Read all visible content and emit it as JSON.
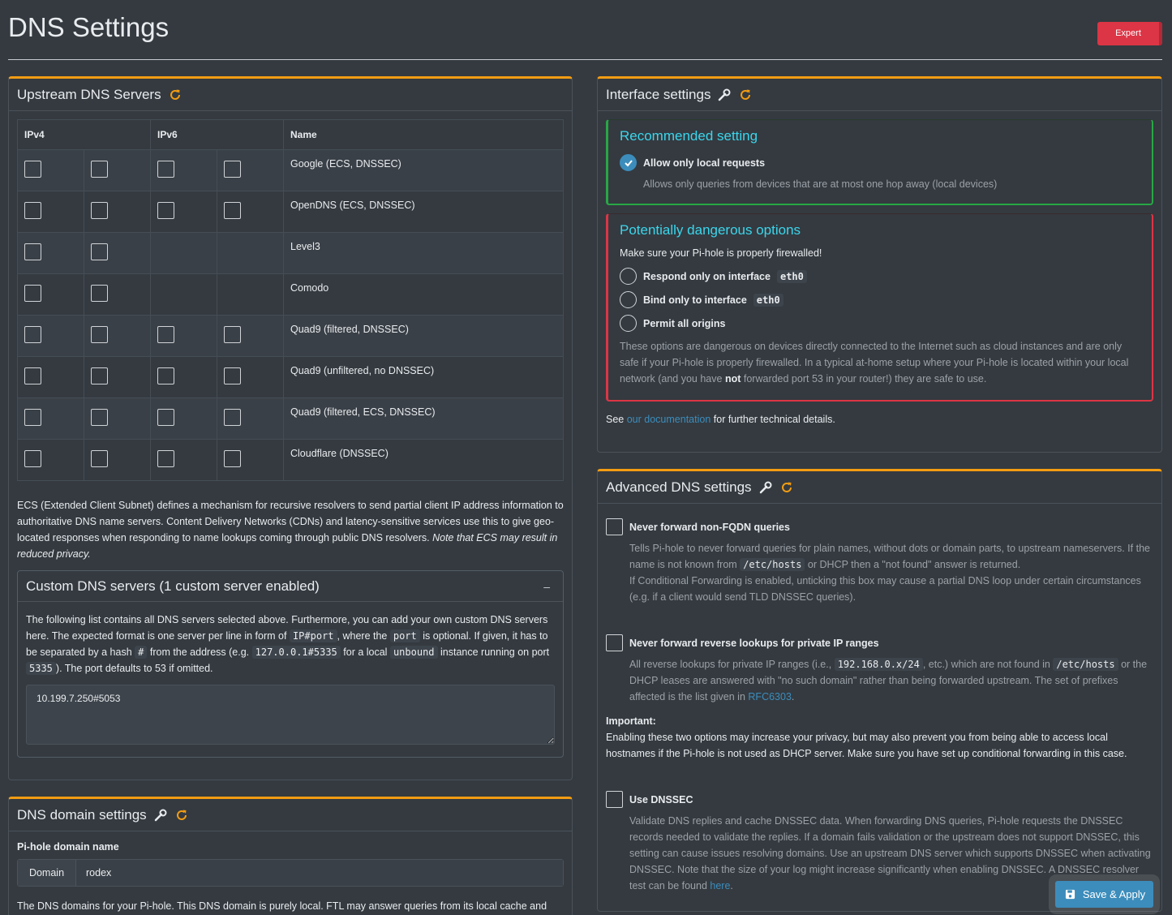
{
  "page": {
    "title": "DNS Settings",
    "expert_label": "Expert"
  },
  "upstream": {
    "title": "Upstream DNS Servers",
    "headers": {
      "ipv4": "IPv4",
      "ipv6": "IPv6",
      "name": "Name"
    },
    "rows": [
      {
        "name": "Google (ECS, DNSSEC)",
        "v4": 2,
        "v6": 2
      },
      {
        "name": "OpenDNS (ECS, DNSSEC)",
        "v4": 2,
        "v6": 2
      },
      {
        "name": "Level3",
        "v4": 2,
        "v6": 0
      },
      {
        "name": "Comodo",
        "v4": 2,
        "v6": 0
      },
      {
        "name": "Quad9 (filtered, DNSSEC)",
        "v4": 2,
        "v6": 2
      },
      {
        "name": "Quad9 (unfiltered, no DNSSEC)",
        "v4": 2,
        "v6": 2
      },
      {
        "name": "Quad9 (filtered, ECS, DNSSEC)",
        "v4": 2,
        "v6": 2
      },
      {
        "name": "Cloudflare (DNSSEC)",
        "v4": 2,
        "v6": 2
      }
    ],
    "ecs_text": "ECS (Extended Client Subnet) defines a mechanism for recursive resolvers to send partial client IP address information to authoritative DNS name servers. Content Delivery Networks (CDNs) and latency-sensitive services use this to give geo-located responses when responding to name lookups coming through public DNS resolvers.",
    "ecs_note": "Note that ECS may result in reduced privacy.",
    "custom": {
      "title": "Custom DNS servers (1 custom server enabled)",
      "collapse": "–",
      "t1": "The following list contains all DNS servers selected above. Furthermore, you can add your own custom DNS servers here. The expected format is one server per line in form of",
      "c1": "IP#port",
      "t2": ", where the",
      "c2": "port",
      "t3": "is optional. If given, it has to be separated by a hash",
      "c3": "#",
      "t4": "from the address (e.g.",
      "c4": "127.0.0.1#5335",
      "t5": "for a local",
      "c5": "unbound",
      "t6": "instance running on port",
      "c6": "5335",
      "t7": "). The port defaults to 53 if omitted.",
      "value": "10.199.7.250#5053"
    }
  },
  "domain": {
    "title": "DNS domain settings",
    "label": "Pi-hole domain name",
    "addon": "Domain",
    "value": "rodex",
    "desc": "The DNS domains for your Pi-hole. This DNS domain is purely local. FTL may answer queries from its local cache and"
  },
  "interface": {
    "title": "Interface settings",
    "recommended_title": "Recommended setting",
    "allow_local": "Allow only local requests",
    "allow_local_desc": "Allows only queries from devices that are at most one hop away (local devices)",
    "danger_title": "Potentially dangerous options",
    "firewall_note": "Make sure your Pi-hole is properly firewalled!",
    "respond_label": "Respond only on interface",
    "bind_label": "Bind only to interface",
    "iface": "eth0",
    "permit_label": "Permit all origins",
    "danger_desc_1": "These options are dangerous on devices directly connected to the Internet such as cloud instances and are only safe if your Pi-hole is properly firewalled. In a typical at-home setup where your Pi-hole is located within your local network (and you have",
    "danger_not": "not",
    "danger_desc_2": "forwarded port 53 in your router!) they are safe to use.",
    "see": "See",
    "doc_link": "our documentation",
    "see_after": "for further technical details."
  },
  "advanced": {
    "title": "Advanced DNS settings",
    "fqdn_label": "Never forward non-FQDN queries",
    "fqdn_d1": "Tells Pi-hole to never forward queries for plain names, without dots or domain parts, to upstream nameservers. If the name is not known from",
    "fqdn_code": "/etc/hosts",
    "fqdn_d2": "or DHCP then a \"not found\" answer is returned.",
    "fqdn_d3": "If Conditional Forwarding is enabled, unticking this box may cause a partial DNS loop under certain circumstances (e.g. if a client would send TLD DNSSEC queries).",
    "rev_label": "Never forward reverse lookups for private IP ranges",
    "rev_d1": "All reverse lookups for private IP ranges (i.e.,",
    "rev_code1": "192.168.0.x/24",
    "rev_d2": ", etc.) which are not found in",
    "rev_code2": "/etc/hosts",
    "rev_d3": "or the DHCP leases are answered with \"no such domain\" rather than being forwarded upstream. The set of prefixes affected is the list given in",
    "rev_link": "RFC6303",
    "rev_d4": ".",
    "important_label": "Important:",
    "important_text": "Enabling these two options may increase your privacy, but may also prevent you from being able to access local hostnames if the Pi-hole is not used as DHCP server. Make sure you have set up conditional forwarding in this case.",
    "dnssec_label": "Use DNSSEC",
    "dnssec_d1": "Validate DNS replies and cache DNSSEC data. When forwarding DNS queries, Pi-hole requests the DNSSEC records needed to validate the replies. If a domain fails validation or the upstream does not support DNSSEC, this setting can cause issues resolving domains. Use an upstream DNS server which supports DNSSEC when activating DNSSEC. Note that the size of your log might increase significantly when enabling DNSSEC. A DNSSEC resolver test can be found",
    "dnssec_link": "here",
    "dnssec_d2": "."
  },
  "save_label": "Save & Apply",
  "colors": {
    "accent": "#f39c12",
    "danger": "#dc3545",
    "success": "#28a745",
    "link": "#3c8dbc",
    "info_title": "#3bd6ec"
  }
}
